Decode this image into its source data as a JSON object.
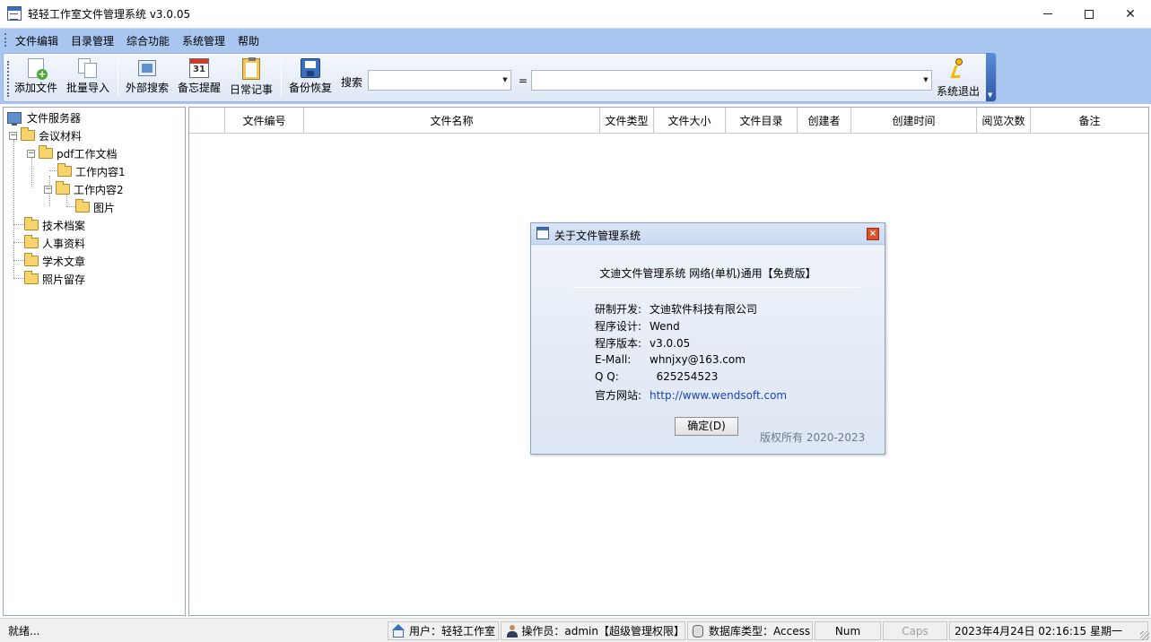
{
  "window": {
    "title": "轻轻工作室文件管理系统 v3.0.05"
  },
  "menu": [
    "文件编辑",
    "目录管理",
    "综合功能",
    "系统管理",
    "帮助"
  ],
  "toolbar": {
    "buttons": [
      "添加文件",
      "批量导入",
      "外部搜索",
      "备忘提醒",
      "日常记事",
      "备份恢复"
    ],
    "search_label": "搜索",
    "equals": "=",
    "exit_label": "系统退出",
    "calendar_num": "31"
  },
  "tree": {
    "root": "文件服务器",
    "items": [
      "会议材料",
      "pdf工作文档",
      "工作内容1",
      "工作内容2",
      "图片",
      "技术档案",
      "人事资料",
      "学术文章",
      "照片留存"
    ],
    "expanders": {
      "minus": "−"
    }
  },
  "grid": {
    "columns": [
      "",
      "文件编号",
      "文件名称",
      "文件类型",
      "文件大小",
      "文件目录",
      "创建者",
      "创建时间",
      "阅览次数",
      "备注"
    ]
  },
  "status": {
    "ready": "就绪...",
    "user": "用户：轻轻工作室",
    "operator": "操作员：admin【超级管理权限】",
    "db": "数据库类型：Access",
    "num": "Num",
    "caps": "Caps",
    "datetime": "2023年4月24日 02:16:15 星期一"
  },
  "dialog": {
    "title": "关于文件管理系统",
    "heading": "文迪文件管理系统  网络(单机)通用【免费版】",
    "rows": [
      {
        "k": "研制开发:",
        "v": "文迪软件科技有限公司"
      },
      {
        "k": "程序设计:",
        "v": "Wend"
      },
      {
        "k": "程序版本:",
        "v": "v3.0.05"
      },
      {
        "k": "E-Mall:",
        "v": "whnjxy@163.com"
      },
      {
        "k": "Q   Q:",
        "v": "  625254523"
      },
      {
        "k": "官方网站:",
        "v": "http://www.wendsoft.com"
      }
    ],
    "ok_label": "确定(D)",
    "copyright": "版权所有 2020-2023",
    "close_glyph": "×"
  },
  "colors": {
    "menubar": "#a9c6f1",
    "link": "#1a43b8"
  }
}
